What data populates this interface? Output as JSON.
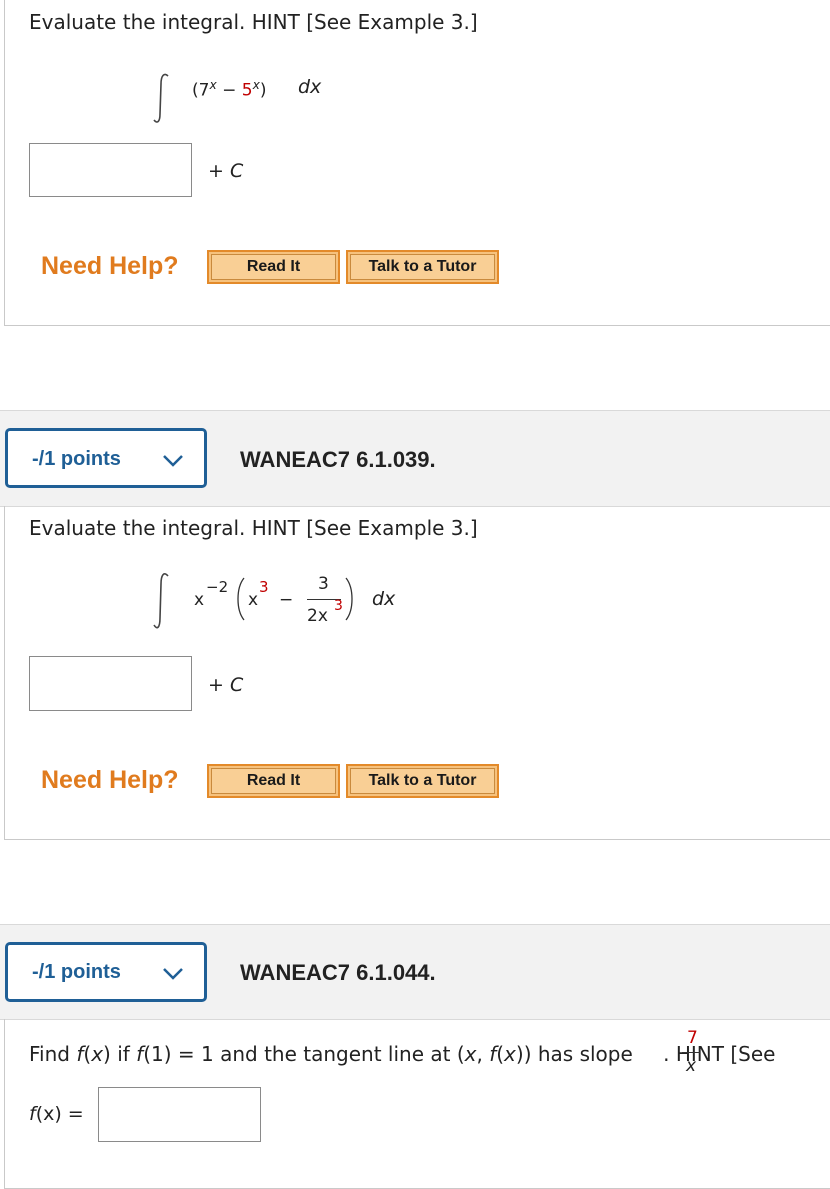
{
  "q1": {
    "instruction": "Evaluate the integral. HINT [See Example 3.]",
    "integral": {
      "open": "(7",
      "exp1": "x",
      "minus": " − ",
      "base2": "5",
      "exp2": "x",
      "close": ")",
      "dx": "dx"
    },
    "plus_c": "+ ",
    "c": "C",
    "need_help": "Need Help?",
    "read_it": "Read It",
    "talk_tutor": "Talk to a Tutor"
  },
  "q2": {
    "points": "-/1 points",
    "id": "WANEAC7 6.1.039.",
    "instruction": "Evaluate the integral. HINT [See Example 3.]",
    "integral": {
      "x": "x",
      "x_exp": "−2",
      "inner_x": "x",
      "inner_exp": "3",
      "minus": "−",
      "numerator": "3",
      "denom_base": "2x",
      "denom_exp": "3",
      "dx": "dx"
    },
    "plus_c": "+ ",
    "c": "C",
    "need_help": "Need Help?",
    "read_it": "Read It",
    "talk_tutor": "Talk to a Tutor"
  },
  "q3": {
    "points": "-/1 points",
    "id": "WANEAC7 6.1.044.",
    "instruction_a": "Find ",
    "f1": "f",
    "instruction_b": "(",
    "x1": "x",
    "instruction_c": ") if ",
    "f2": "f",
    "instruction_d": "(1)  =  1 and the tangent line at (",
    "x2": "x",
    "instruction_e": ", ",
    "f3": "f",
    "instruction_f": "(",
    "x3": "x",
    "instruction_g": ")) has slope ",
    "slope_num": "7",
    "slope_den": "x",
    "instruction_h": ". HINT [See",
    "answer_label_f": "f",
    "answer_label_rest": "(x)  ="
  },
  "colors": {
    "accent_blue": "#1f5f96",
    "help_orange": "#e07b1e",
    "exponent_red": "#c00000"
  }
}
